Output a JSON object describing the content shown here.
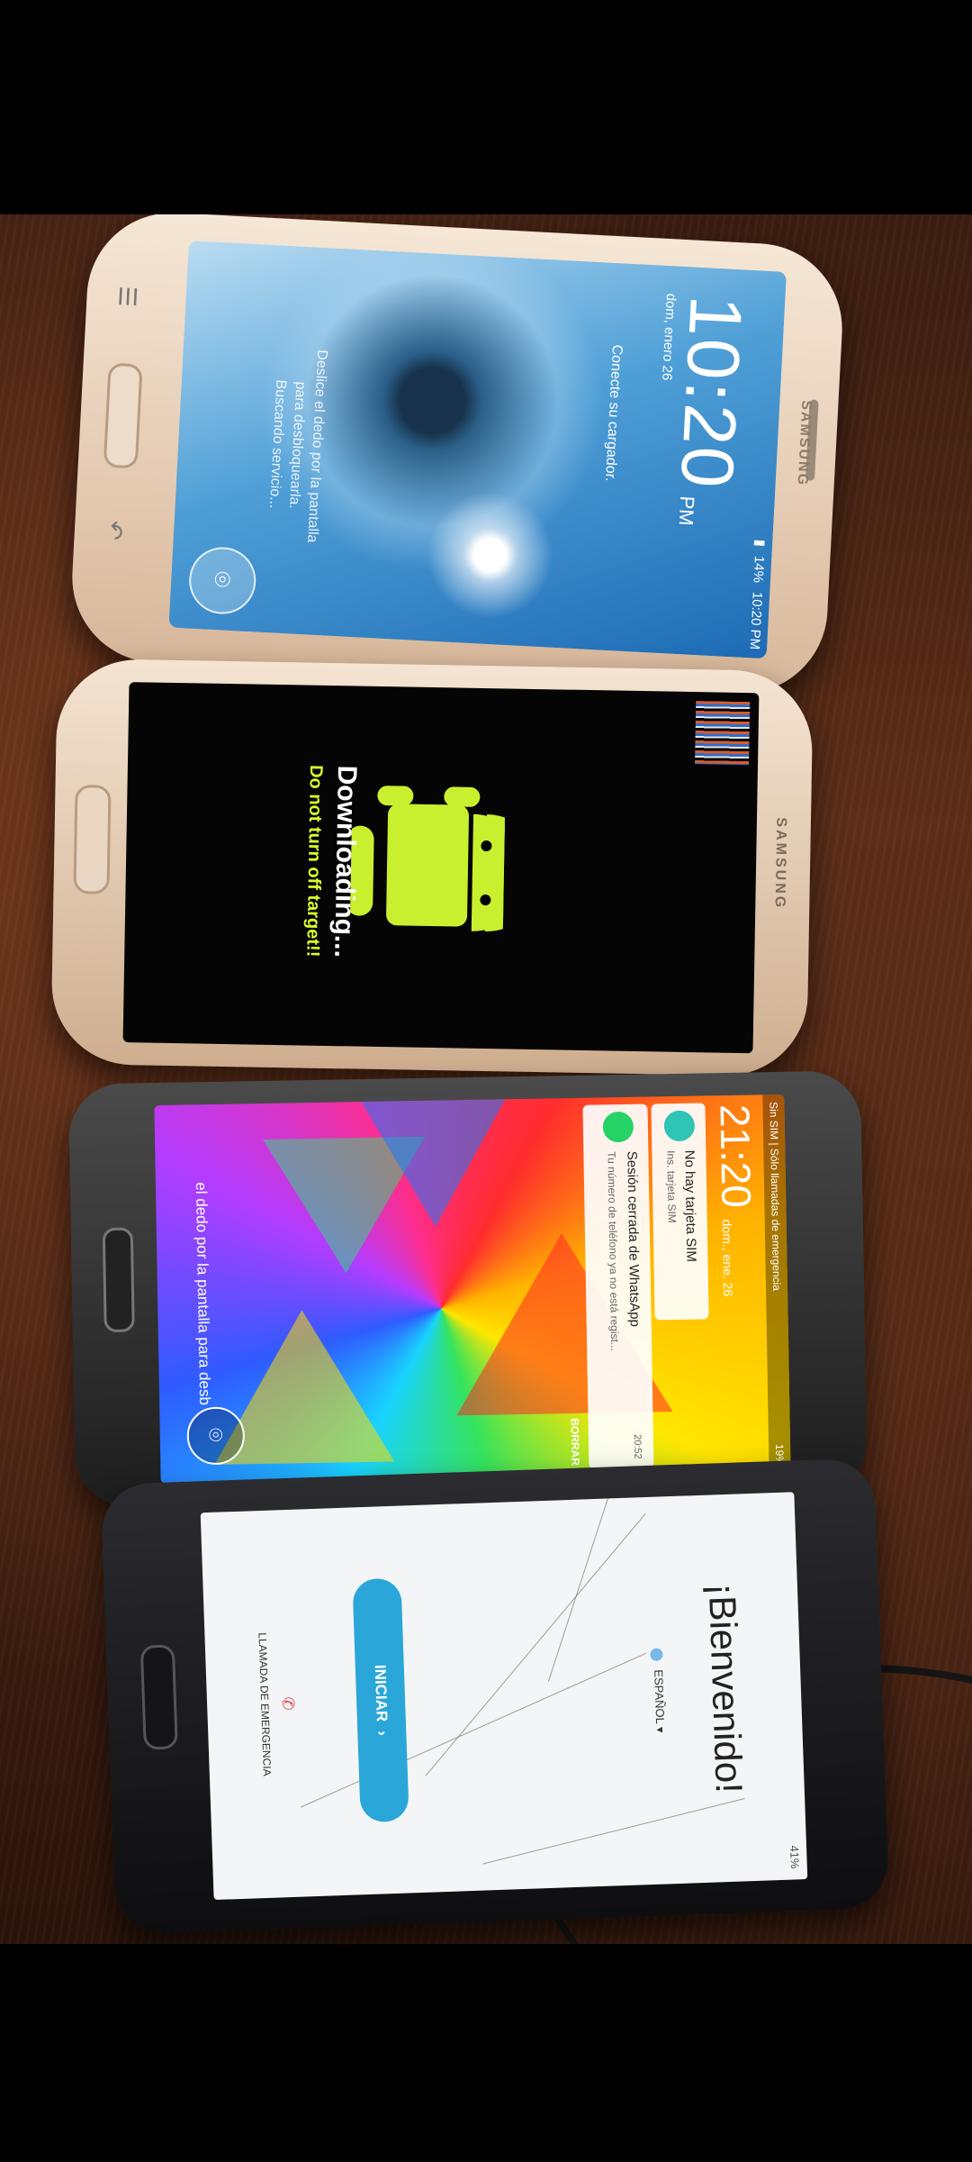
{
  "phone1": {
    "carrier_icons": "14%",
    "status_time": "10:20 PM",
    "brand": "SAMSUNG",
    "clock_time": "10:20",
    "clock_ampm": "PM",
    "date": "dom, enero 26",
    "charger_text": "Conecte su cargador.",
    "unlock_hint_1": "Deslice el dedo por la pantalla",
    "unlock_hint_2": "para desbloquearla.",
    "unlock_hint_3": "Buscando servicio..."
  },
  "phone2": {
    "brand": "SAMSUNG",
    "title": "Downloading...",
    "warning": "Do not turn off target!!"
  },
  "phone3": {
    "status_left": "Sin SIM | Sólo llamadas de emergencia",
    "battery": "19%",
    "time": "21:20",
    "date": "dom., ene. 26",
    "notif1_title": "No hay tarjeta SIM",
    "notif1_body": "Ins. tarjeta SIM",
    "notif2_title": "Sesión cerrada de WhatsApp",
    "notif2_time": "20:52",
    "notif2_body": "Tu número de teléfono ya no está regist...",
    "notif_clear": "BORRAR",
    "unlock_hint": "el dedo por la pantalla para desb"
  },
  "phone4": {
    "status": "41%",
    "welcome": "¡Bienvenido!",
    "language": "ESPAÑOL",
    "start_button": "INICIAR",
    "emergency": "LLAMADA DE EMERGENCIA"
  },
  "colors": {
    "android_green": "#a4e635",
    "download_yellow": "#d8ff2a",
    "start_button": "#2aa7d8"
  }
}
